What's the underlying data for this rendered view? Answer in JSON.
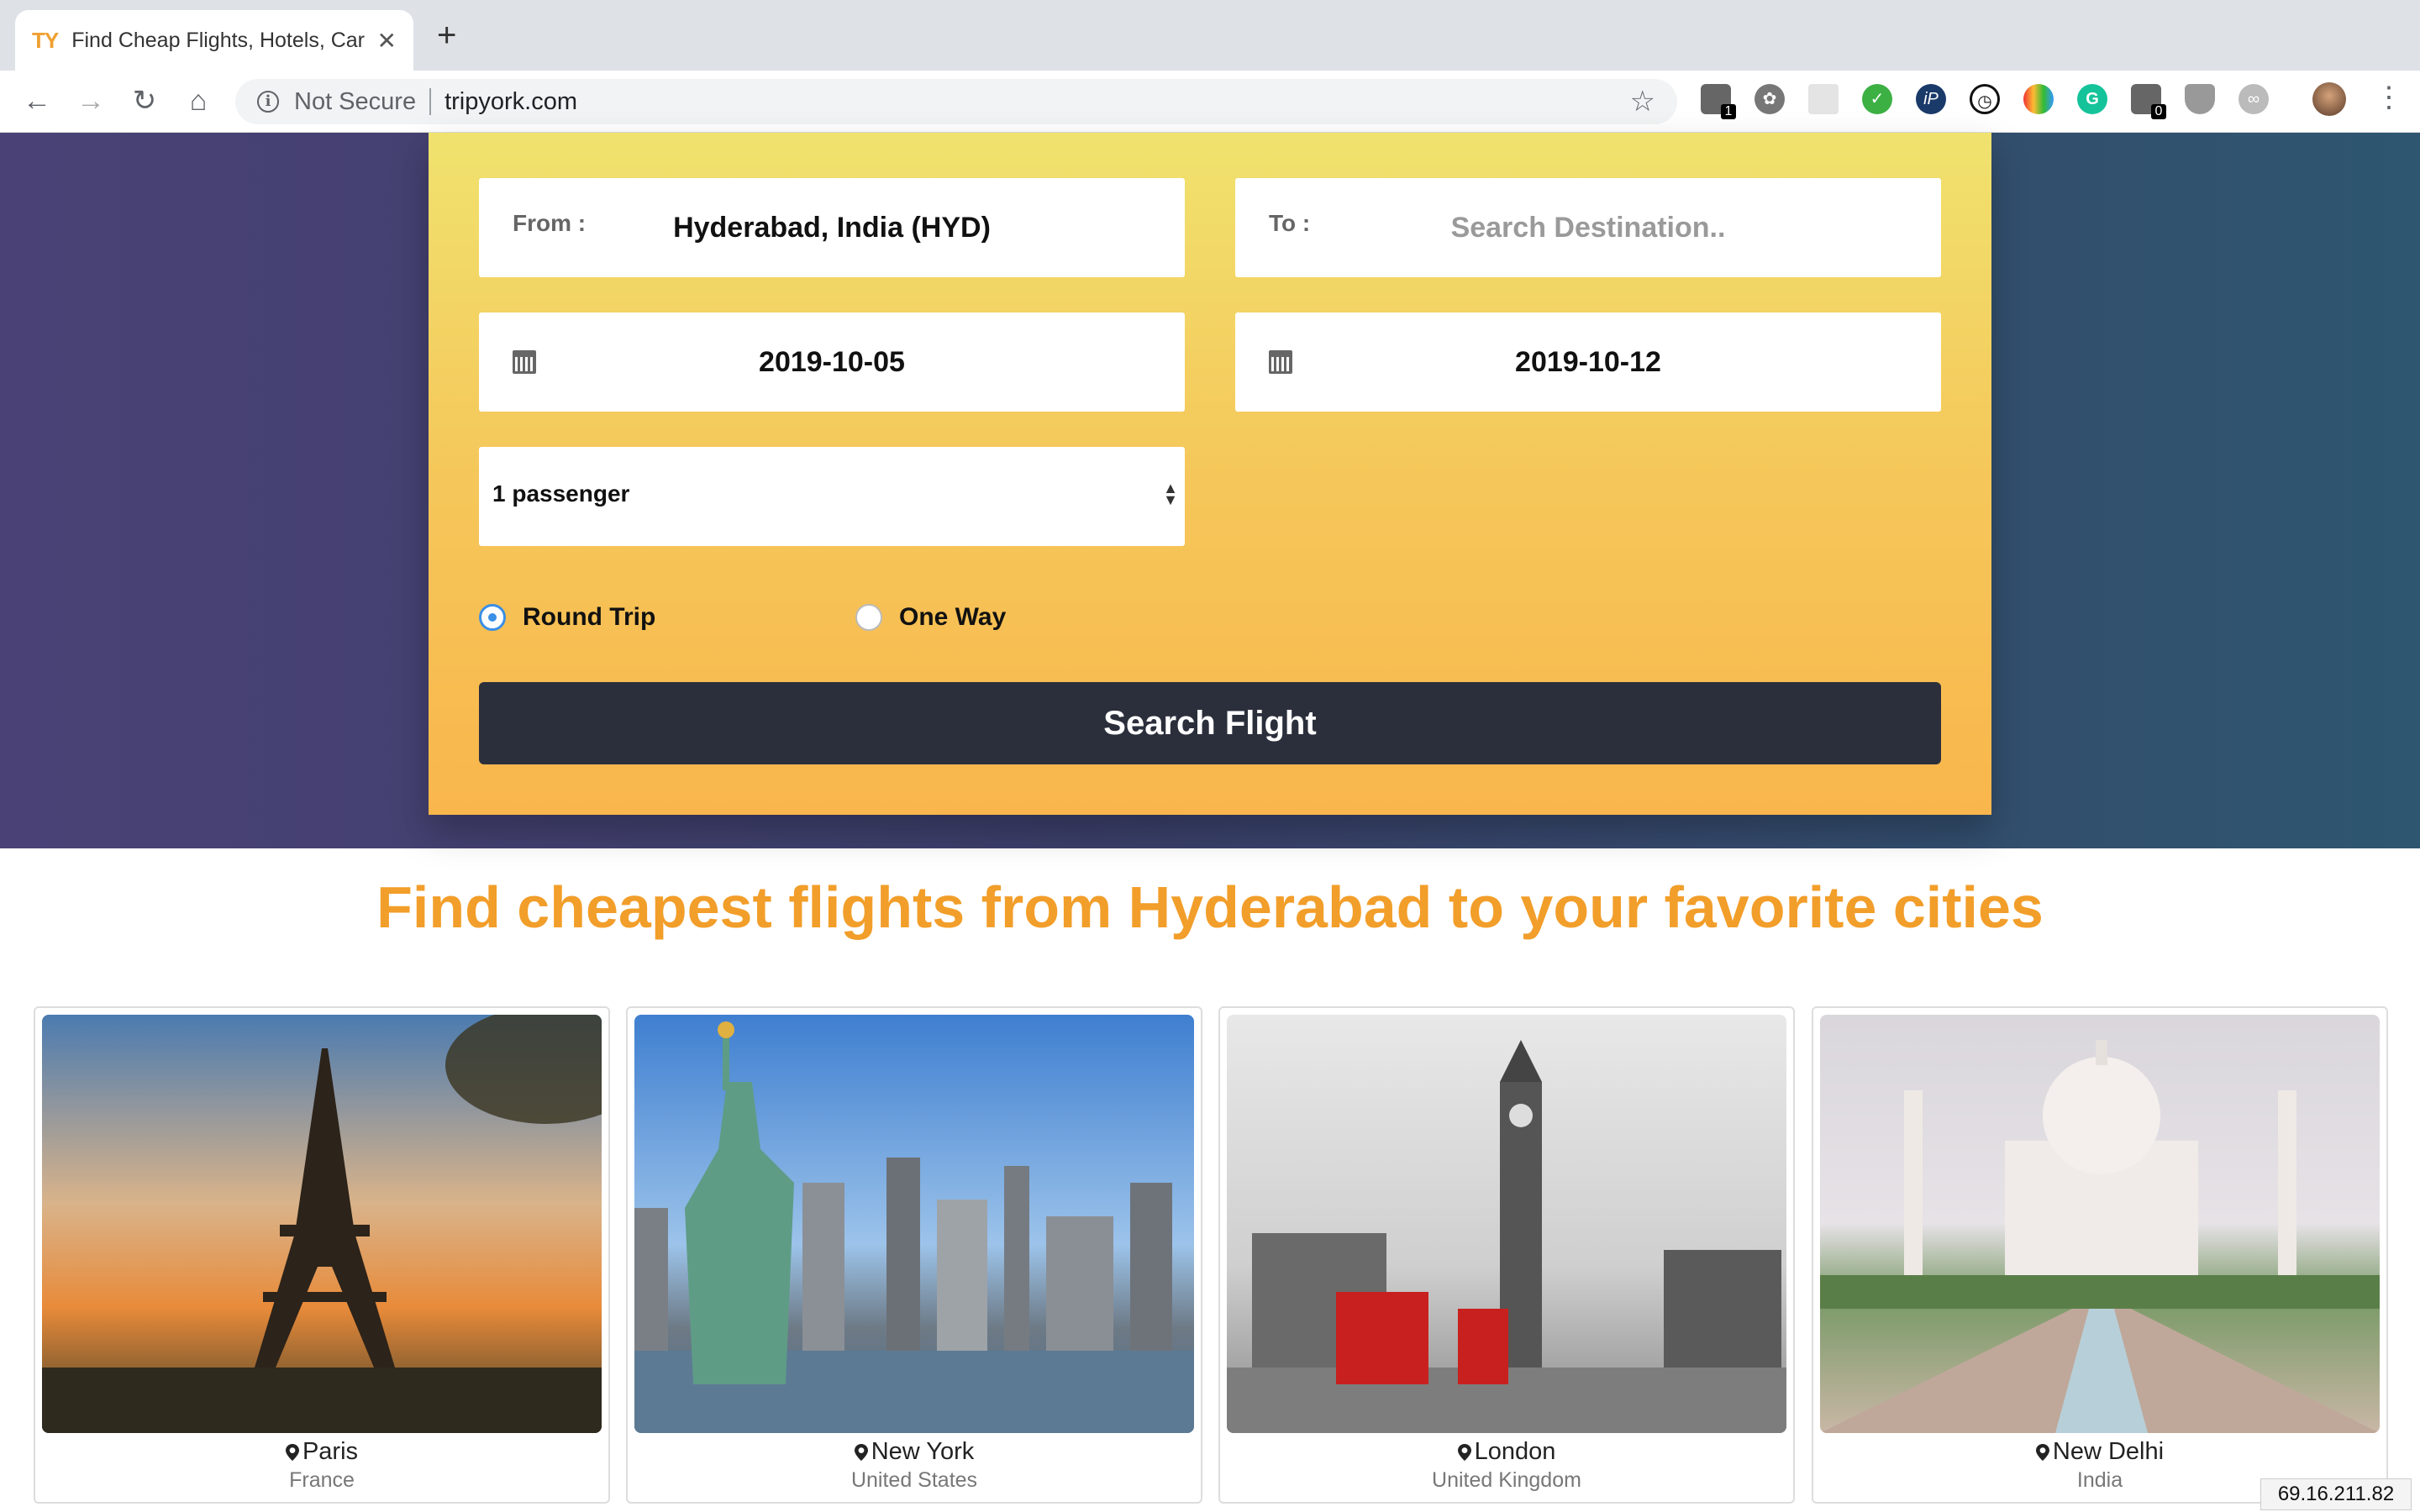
{
  "browser": {
    "tab_title": "Find Cheap Flights, Hotels, Car",
    "tab_favicon": "TY",
    "security_label": "Not Secure",
    "url": "tripyork.com",
    "ext_badges": [
      "1",
      "0"
    ]
  },
  "search": {
    "from_label": "From :",
    "from_value": "Hyderabad, India (HYD)",
    "to_label": "To :",
    "to_placeholder": "Search Destination..",
    "depart_date": "2019-10-05",
    "return_date": "2019-10-12",
    "passengers": "1 passenger",
    "trip_types": [
      "Round Trip",
      "One Way"
    ],
    "selected_trip": "Round Trip",
    "submit_label": "Search Flight"
  },
  "headline": "Find cheapest flights from Hyderabad to your favorite cities",
  "destinations": [
    {
      "city": "Paris",
      "country": "France"
    },
    {
      "city": "New York",
      "country": "United States"
    },
    {
      "city": "London",
      "country": "United Kingdom"
    },
    {
      "city": "New Delhi",
      "country": "India"
    }
  ],
  "ip_address": "69.16.211.82",
  "colors": {
    "accent": "#f29e2a",
    "button": "#2b2f3c",
    "radio": "#3a8fe6"
  }
}
